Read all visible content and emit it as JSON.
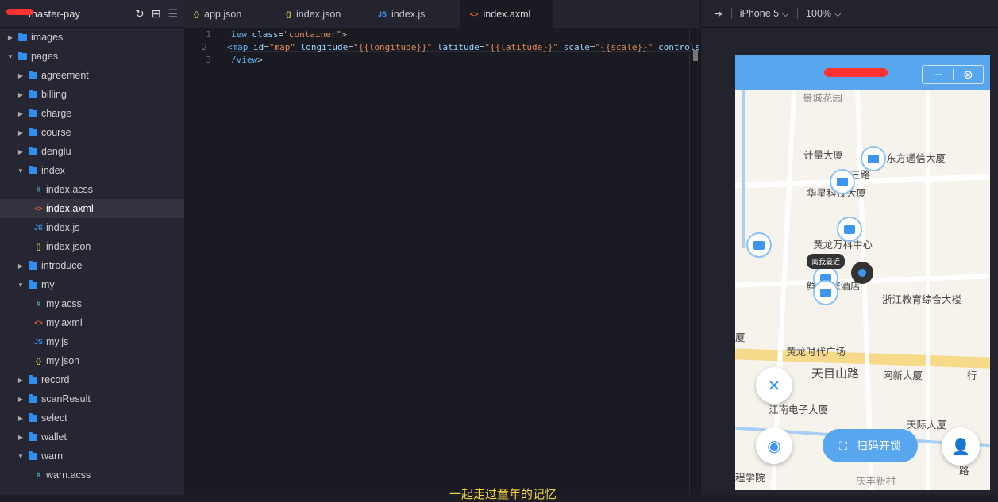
{
  "sidebar": {
    "project_suffix": "master-pay",
    "items": [
      {
        "label": "images",
        "type": "folder",
        "level": 0,
        "open": false
      },
      {
        "label": "pages",
        "type": "folder",
        "level": 0,
        "open": true
      },
      {
        "label": "agreement",
        "type": "folder",
        "level": 1,
        "open": false
      },
      {
        "label": "billing",
        "type": "folder",
        "level": 1,
        "open": false
      },
      {
        "label": "charge",
        "type": "folder",
        "level": 1,
        "open": false
      },
      {
        "label": "course",
        "type": "folder",
        "level": 1,
        "open": false
      },
      {
        "label": "denglu",
        "type": "folder",
        "level": 1,
        "open": false
      },
      {
        "label": "index",
        "type": "folder",
        "level": 1,
        "open": true
      },
      {
        "label": "index.acss",
        "type": "acss",
        "level": 2
      },
      {
        "label": "index.axml",
        "type": "axml",
        "level": 2,
        "selected": true
      },
      {
        "label": "index.js",
        "type": "js",
        "level": 2
      },
      {
        "label": "index.json",
        "type": "json",
        "level": 2
      },
      {
        "label": "introduce",
        "type": "folder",
        "level": 1,
        "open": false
      },
      {
        "label": "my",
        "type": "folder",
        "level": 1,
        "open": true
      },
      {
        "label": "my.acss",
        "type": "acss",
        "level": 2
      },
      {
        "label": "my.axml",
        "type": "axml",
        "level": 2
      },
      {
        "label": "my.js",
        "type": "js",
        "level": 2
      },
      {
        "label": "my.json",
        "type": "json",
        "level": 2
      },
      {
        "label": "record",
        "type": "folder",
        "level": 1,
        "open": false
      },
      {
        "label": "scanResult",
        "type": "folder",
        "level": 1,
        "open": false
      },
      {
        "label": "select",
        "type": "folder",
        "level": 1,
        "open": false
      },
      {
        "label": "wallet",
        "type": "folder",
        "level": 1,
        "open": false
      },
      {
        "label": "warn",
        "type": "folder",
        "level": 1,
        "open": true
      },
      {
        "label": "warn.acss",
        "type": "acss",
        "level": 2
      }
    ]
  },
  "tabs": [
    {
      "label": "app.json",
      "type": "json"
    },
    {
      "label": "index.json",
      "type": "json"
    },
    {
      "label": "index.js",
      "type": "js"
    },
    {
      "label": "index.axml",
      "type": "axml",
      "active": true
    }
  ],
  "editor": {
    "lines": [
      {
        "n": "1",
        "parts": [
          [
            "kw",
            "iew "
          ],
          [
            "at",
            "class"
          ],
          [
            "pl",
            "="
          ],
          [
            "st",
            "\"container\""
          ],
          [
            "pl",
            ">"
          ]
        ]
      },
      {
        "n": "2",
        "parts": [
          [
            "kw",
            "<map "
          ],
          [
            "at",
            "id"
          ],
          [
            "pl",
            "="
          ],
          [
            "st",
            "\"map\" "
          ],
          [
            "at",
            "longitude"
          ],
          [
            "pl",
            "="
          ],
          [
            "st",
            "\"{{longitude}}\" "
          ],
          [
            "at",
            "latitude"
          ],
          [
            "pl",
            "="
          ],
          [
            "st",
            "\"{{latitude}}\" "
          ],
          [
            "at",
            "scale"
          ],
          [
            "pl",
            "="
          ],
          [
            "st",
            "\"{{scale}}\" "
          ],
          [
            "at",
            "controls"
          ]
        ]
      },
      {
        "n": "3",
        "parts": [
          [
            "kw",
            "/view"
          ],
          [
            "pl",
            ">"
          ]
        ]
      }
    ]
  },
  "bottom_text": "一起走过童年的记忆",
  "preview": {
    "device": "iPhone 5",
    "zoom": "100%",
    "map_labels": [
      "景城花园",
      "计量大厦",
      "东方通信大厦",
      "三路",
      "华星科技大厦",
      "黄龙万科中心",
      "鲜",
      "旅酒店",
      "浙江教育综合大楼",
      "厦",
      "黄龙时代广场",
      "天目山路",
      "网新大厦",
      "行",
      "江南电子大厦",
      "天际大厦",
      "程学院",
      "庆丰新村",
      "路"
    ],
    "tooltip": "离我最近",
    "scan_button": "扫码开锁"
  },
  "colors": {
    "accent": "#57a6ee",
    "button": "#3c95ef"
  }
}
